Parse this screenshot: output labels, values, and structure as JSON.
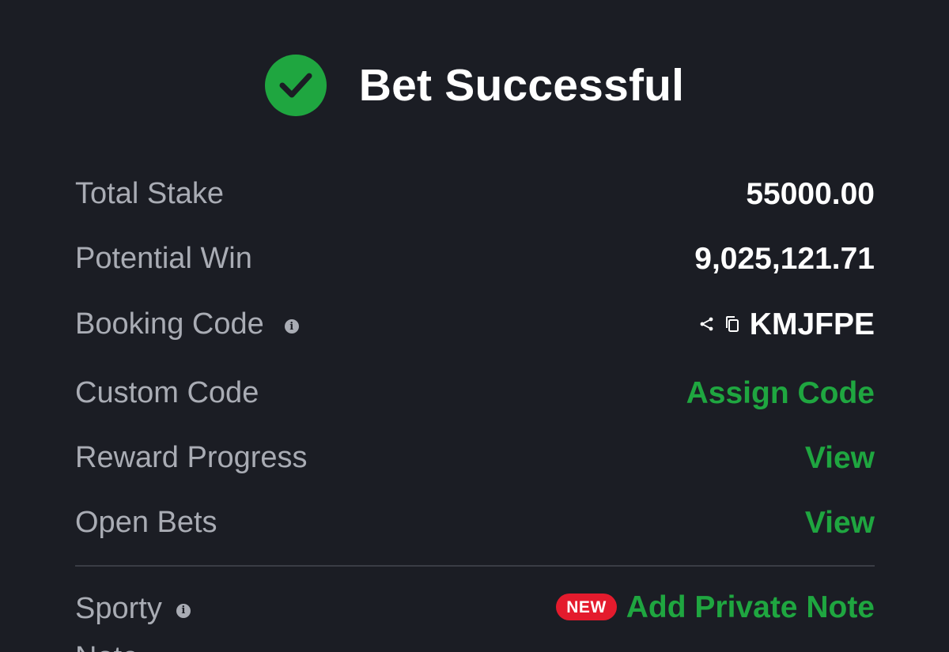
{
  "header": {
    "title": "Bet Successful"
  },
  "rows": [
    {
      "label": "Total Stake",
      "value": "55000.00"
    },
    {
      "label": "Potential Win",
      "value": "9,025,121.71"
    },
    {
      "label": "Booking Code",
      "value": "KMJFPE"
    },
    {
      "label": "Custom Code",
      "value": "Assign Code"
    },
    {
      "label": "Reward Progress",
      "value": "View"
    },
    {
      "label": "Open Bets",
      "value": "View"
    }
  ],
  "sporty_note": {
    "label_line1": "Sporty",
    "label_line2": "Note",
    "badge": "NEW",
    "action": "Add Private Note"
  },
  "colors": {
    "background": "#1b1d24",
    "accent_green": "#1fa640",
    "badge_red": "#e41b2d",
    "label_gray": "#a9acb4"
  },
  "icons": {
    "success": "check-circle-icon",
    "info": "info-icon",
    "share": "share-icon",
    "copy": "copy-icon"
  }
}
